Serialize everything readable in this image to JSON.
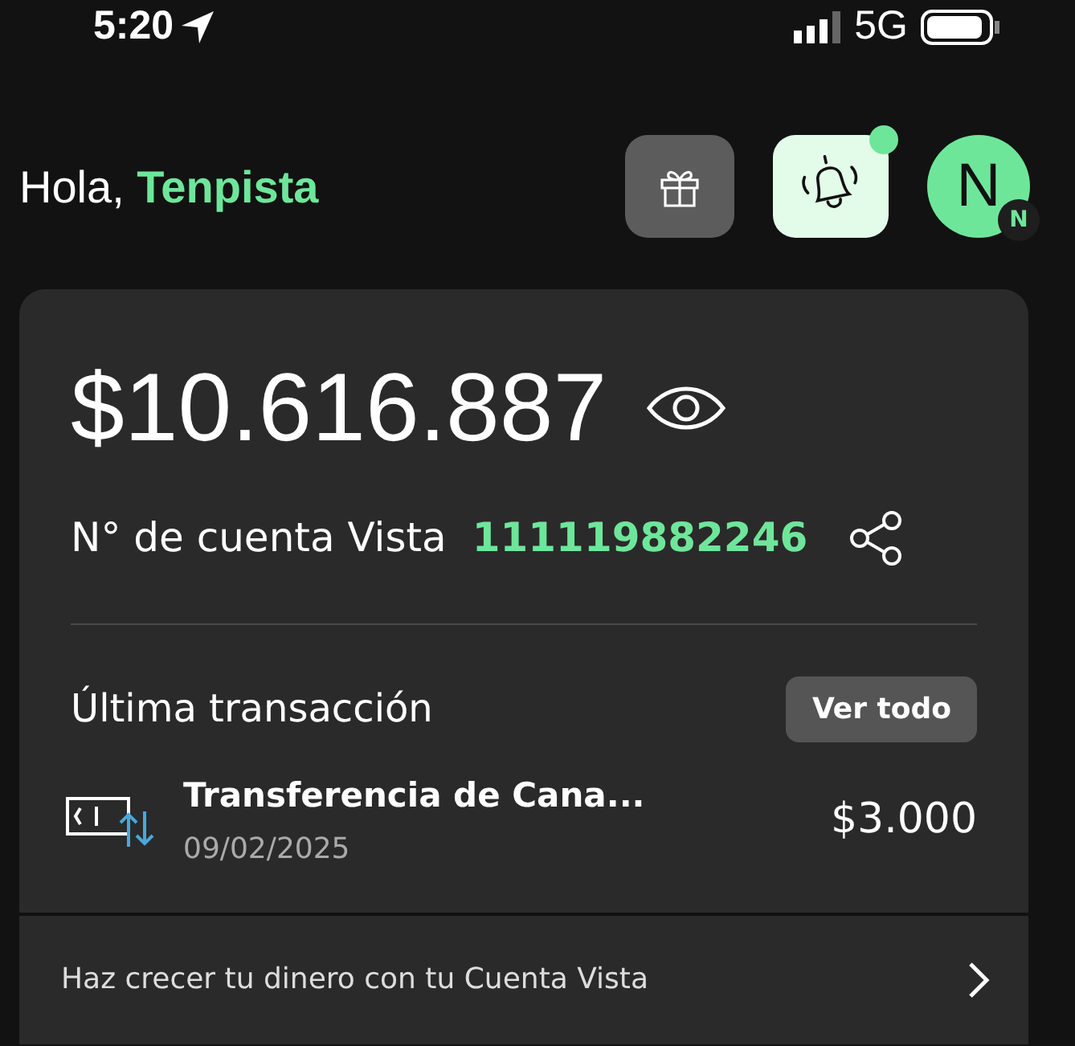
{
  "status_bar": {
    "time": "5:20",
    "network": "5G"
  },
  "header": {
    "greeting": "Hola, **Tenpista**",
    "notifications": {
      "unread": true
    },
    "avatar": {
      "letter": "N",
      "badge": "N"
    }
  },
  "account_card": {
    "balance": "$10.616.887",
    "account_label": "N° de cuenta Vista",
    "account_number": "111119882246",
    "last_transaction": {
      "title": "Última transacción",
      "view_all": "Ver todo",
      "items": [
        {
          "name": "Transferencia de Cana...",
          "date": "09/02/2025",
          "amount": "$3.000"
        }
      ]
    },
    "promo": "Haz crecer tu dinero con tu Cuenta Vista"
  }
}
